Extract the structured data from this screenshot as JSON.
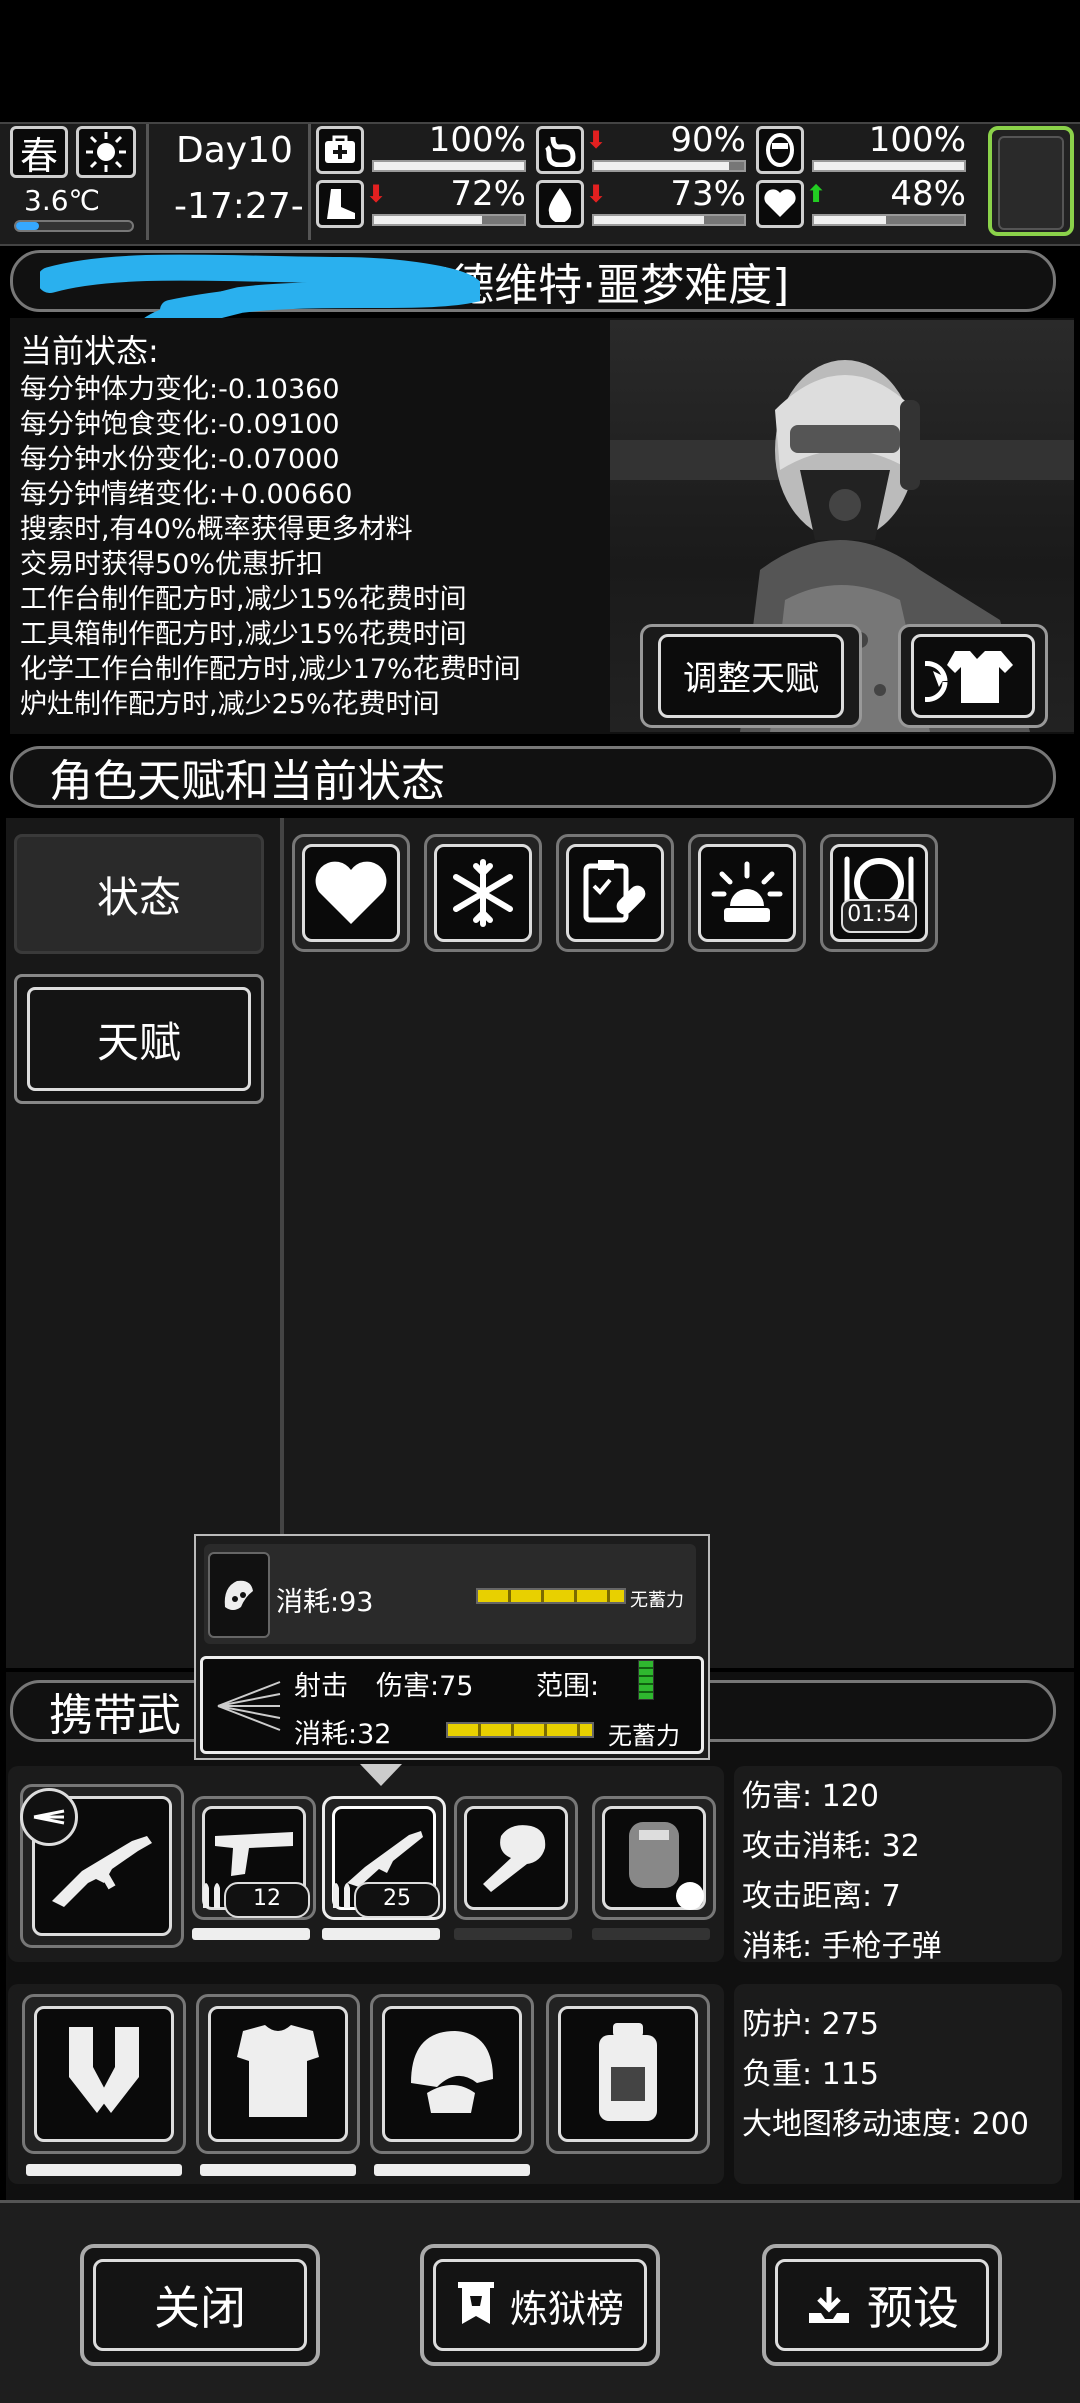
{
  "top": {
    "season": "春",
    "temperature": "3.6℃",
    "day": "Day10",
    "time": "-17:27-",
    "stats": [
      {
        "icon": "medkit-icon",
        "value": "100%",
        "level": 1.0,
        "arrow": ""
      },
      {
        "icon": "stomach-icon",
        "value": "90%",
        "level": 0.9,
        "arrow": "down"
      },
      {
        "icon": "shield-icon",
        "value": "100%",
        "level": 1.0,
        "arrow": ""
      },
      {
        "icon": "boot-icon",
        "value": "72%",
        "level": 0.72,
        "arrow": "down"
      },
      {
        "icon": "water-drop-icon",
        "value": "73%",
        "level": 0.73,
        "arrow": "down"
      },
      {
        "icon": "heart-icon",
        "value": "48%",
        "level": 0.48,
        "arrow": "up"
      }
    ],
    "temperature_level": 0.2
  },
  "character": {
    "name_title": "[德维特·噩梦难度]",
    "status_heading": "当前状态:",
    "effects": [
      "每分钟体力变化:-0.10360",
      "每分钟饱食变化:-0.09100",
      "每分钟水份变化:-0.07000",
      "每分钟情绪变化:+0.00660",
      "搜索时,有40%概率获得更多材料",
      "交易时获得50%优惠折扣",
      "工作台制作配方时,减少15%花费时间",
      "工具箱制作配方时,减少15%花费时间",
      "化学工作台制作配方时,减少17%花费时间",
      "炉灶制作配方时,减少25%花费时间"
    ],
    "adjust_button": "调整天赋"
  },
  "talent_section": {
    "header": "角色天赋和当前状态",
    "tabs": [
      "状态",
      "天赋"
    ],
    "status_icons": [
      "heart-icon",
      "snowflake-icon",
      "medicine-icon",
      "alarm-icon",
      "meal-icon"
    ],
    "meal_timer": "01:54"
  },
  "tooltip": {
    "row1_cost": "消耗:93",
    "row1_charge": "无蓄力",
    "row2_type": "射击",
    "row2_damage": "伤害:75",
    "row2_range": "范围:",
    "row2_cost": "消耗:32",
    "row2_charge": "无蓄力"
  },
  "weapons": {
    "header": "携带武",
    "slots": [
      {
        "icon": "pistol-icon",
        "ammo": "12"
      },
      {
        "icon": "smg-icon",
        "ammo": "25"
      },
      {
        "icon": "fist-icon",
        "ammo": ""
      },
      {
        "icon": "riot-shield-icon",
        "ammo": ""
      }
    ],
    "stats": [
      "伤害: 120",
      "攻击消耗: 32",
      "攻击距离: 7",
      "消耗: 手枪子弹"
    ]
  },
  "armor": {
    "slots": [
      "gauntlets-icon",
      "body-armor-icon",
      "helmet-icon",
      "backpack-icon"
    ],
    "stats": [
      "防护: 275",
      "负重: 115",
      "大地图移动速度: 200"
    ]
  },
  "bottom": {
    "close": "关闭",
    "ranking": "炼狱榜",
    "preset": "预设"
  }
}
